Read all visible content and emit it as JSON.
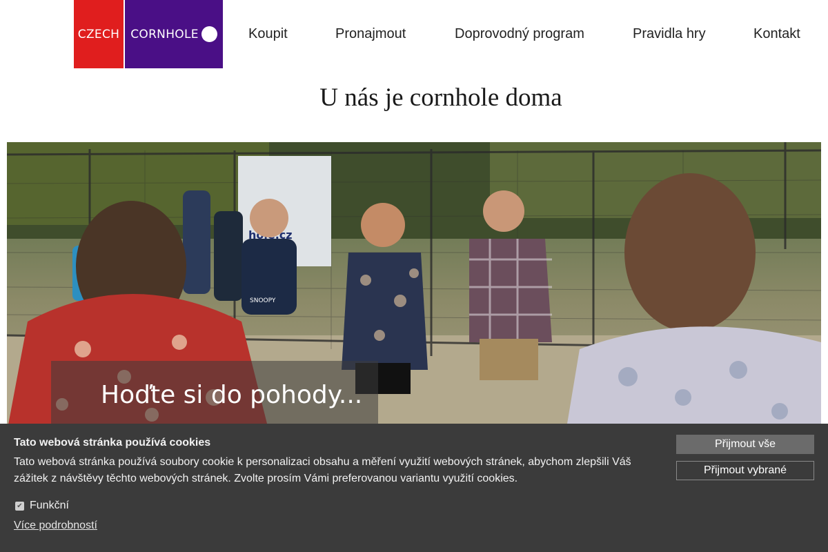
{
  "logo": {
    "left_text": "CZECH",
    "right_text": "CORNHOLE"
  },
  "nav": [
    {
      "label": "Koupit"
    },
    {
      "label": "Pronajmout"
    },
    {
      "label": "Doprovodný program"
    },
    {
      "label": "Pravidla hry"
    },
    {
      "label": "Kontakt"
    }
  ],
  "page_title": "U nás je cornhole doma",
  "hero": {
    "caption": "Hoďte si do pohody...",
    "banner_text": "hole.cz",
    "shirt_text": "SNOOPY"
  },
  "cookie": {
    "title": "Tato webová stránka používá cookies",
    "text": "Tato webová stránka používá soubory cookie k personalizaci obsahu a měření využití webových stránek, abychom zlepšili Váš zážitek z návštěvy těchto webových stránek. Zvolte prosím Vámi preferovanou variantu využití cookies.",
    "option_functional": "Funkční",
    "more_link": "Více podrobností",
    "accept_all": "Přijmout vše",
    "accept_selected": "Přijmout vybrané"
  },
  "colors": {
    "logo_red": "#e01e1e",
    "logo_purple": "#4a0f86",
    "cookie_bg": "#3b3b3b"
  }
}
